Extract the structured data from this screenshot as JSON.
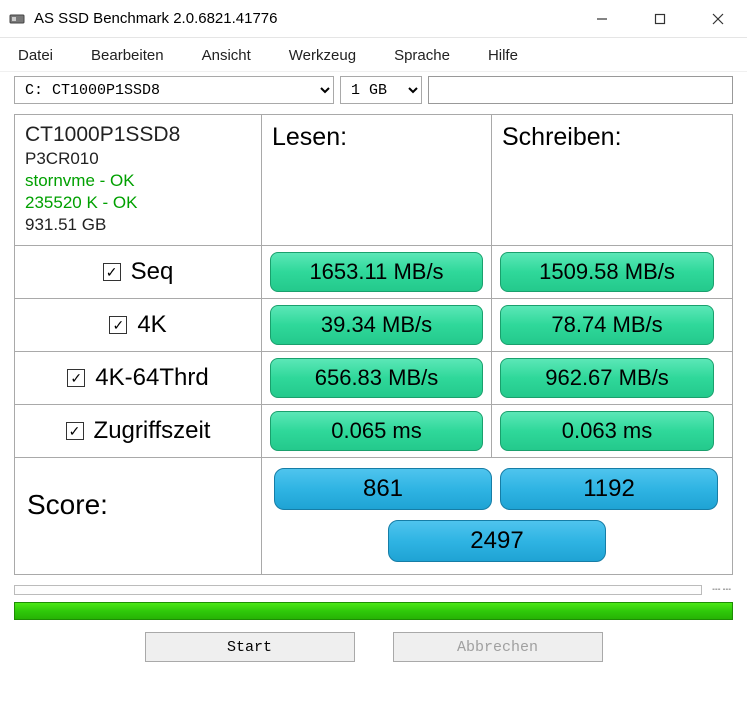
{
  "window": {
    "title": "AS SSD Benchmark 2.0.6821.41776"
  },
  "menu": {
    "datei": "Datei",
    "bearbeiten": "Bearbeiten",
    "ansicht": "Ansicht",
    "werkzeug": "Werkzeug",
    "sprache": "Sprache",
    "hilfe": "Hilfe"
  },
  "toolbar": {
    "drive": "C: CT1000P1SSD8",
    "size": "1 GB"
  },
  "headers": {
    "read": "Lesen:",
    "write": "Schreiben:"
  },
  "device": {
    "name": "CT1000P1SSD8",
    "firmware": "P3CR010",
    "driver_ok": "stornvme - OK",
    "align_ok": "235520 K - OK",
    "capacity": "931.51 GB"
  },
  "rows": {
    "seq": {
      "label": "Seq",
      "read": "1653.11 MB/s",
      "write": "1509.58 MB/s"
    },
    "k4": {
      "label": "4K",
      "read": "39.34 MB/s",
      "write": "78.74 MB/s"
    },
    "k4t": {
      "label": "4K-64Thrd",
      "read": "656.83 MB/s",
      "write": "962.67 MB/s"
    },
    "acc": {
      "label": "Zugriffszeit",
      "read": "0.065 ms",
      "write": "0.063 ms"
    }
  },
  "score": {
    "label": "Score:",
    "read": "861",
    "write": "1192",
    "total": "2497"
  },
  "buttons": {
    "start": "Start",
    "abort": "Abbrechen"
  },
  "chart_data": {
    "type": "table",
    "device": "CT1000P1SSD8",
    "firmware": "P3CR010",
    "capacity_gb": 931.51,
    "test_size": "1 GB",
    "driver": "stornvme",
    "alignment_k": 235520,
    "results": [
      {
        "test": "Seq",
        "read_mb_s": 1653.11,
        "write_mb_s": 1509.58
      },
      {
        "test": "4K",
        "read_mb_s": 39.34,
        "write_mb_s": 78.74
      },
      {
        "test": "4K-64Thrd",
        "read_mb_s": 656.83,
        "write_mb_s": 962.67
      },
      {
        "test": "Zugriffszeit",
        "read_ms": 0.065,
        "write_ms": 0.063
      }
    ],
    "score": {
      "read": 861,
      "write": 1192,
      "total": 2497
    }
  }
}
